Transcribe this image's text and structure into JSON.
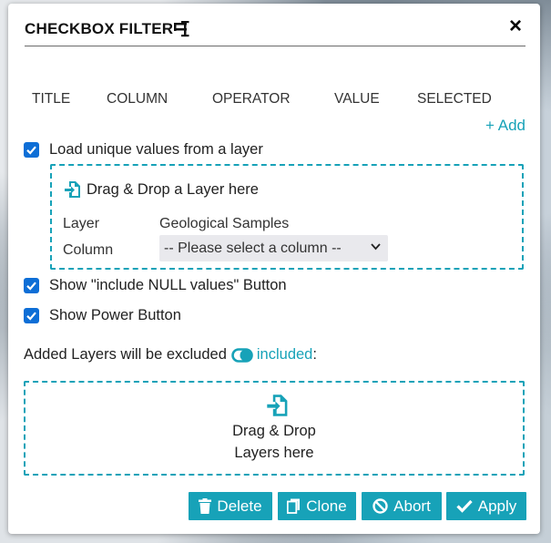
{
  "dialog": {
    "title": "CHECKBOX FILTER",
    "close_label": "×"
  },
  "columns": [
    "TITLE",
    "COLUMN",
    "OPERATOR",
    "VALUE",
    "SELECTED"
  ],
  "add_label": "+ Add",
  "options": {
    "load_unique": {
      "label": "Load unique values from a layer",
      "checked": true
    },
    "include_null": {
      "label": "Show \"include NULL values\" Button",
      "checked": true
    },
    "power_button": {
      "label": "Show Power Button",
      "checked": true
    }
  },
  "layer_source": {
    "drop_text": "Drag & Drop a Layer here",
    "layer_label": "Layer",
    "layer_value": "Geological Samples",
    "column_label": "Column",
    "column_select": "-- Please select a column --"
  },
  "exclusion": {
    "prefix": "Added Layers will be excluded",
    "toggle_state": "included",
    "suffix": ":"
  },
  "layers_drop": {
    "line1": "Drag & Drop",
    "line2": "Layers here"
  },
  "buttons": {
    "delete": "Delete",
    "clone": "Clone",
    "abort": "Abort",
    "apply": "Apply"
  },
  "colors": {
    "accent": "#17a2b8",
    "checkbox": "#0d6ed6"
  }
}
